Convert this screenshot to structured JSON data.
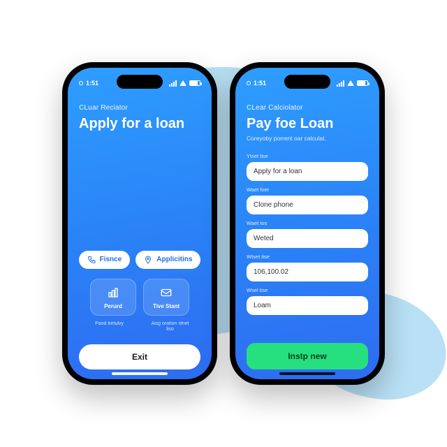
{
  "status": {
    "time": "1:51",
    "signal_icon": "signal-icon",
    "wifi_icon": "wifi-icon",
    "battery_icon": "battery-icon"
  },
  "phone1": {
    "brand_prefix": "C",
    "brand_rest": "Luar Reciator",
    "title": "Apply for a loan",
    "pills": [
      {
        "icon": "phone-icon",
        "label": "Fisnce"
      },
      {
        "icon": "pin-icon",
        "label": "Applicitins"
      }
    ],
    "tiles": [
      {
        "icon": "chart-icon",
        "label": "Perurd"
      },
      {
        "icon": "mail-icon",
        "label": "Tive Stant"
      }
    ],
    "captions": [
      "Paod tretulvy",
      "Aisg oration sfnet liso"
    ],
    "exit_label": "Exit"
  },
  "phone2": {
    "brand_prefix": "C",
    "brand_rest": "Lear Calciolator",
    "title": "Pay foe Loan",
    "subtitle": "Coreyoby porrent oar calculat.",
    "fields": [
      {
        "label": "Ytset tise",
        "value": "Apply for a loan"
      },
      {
        "label": "Waet foer",
        "value": "Clone phone"
      },
      {
        "label": "Waet tos",
        "value": "Weted"
      },
      {
        "label": "Wtset tise",
        "value": "106,100.02"
      },
      {
        "label": "Wsel tise",
        "value": "Loam"
      }
    ],
    "submit_label": "Instp new"
  },
  "colors": {
    "accent_green": "#26e07f",
    "gradient_top": "#2e9dff",
    "gradient_bottom": "#2e6cf2",
    "blob": "#b9e0f5"
  }
}
